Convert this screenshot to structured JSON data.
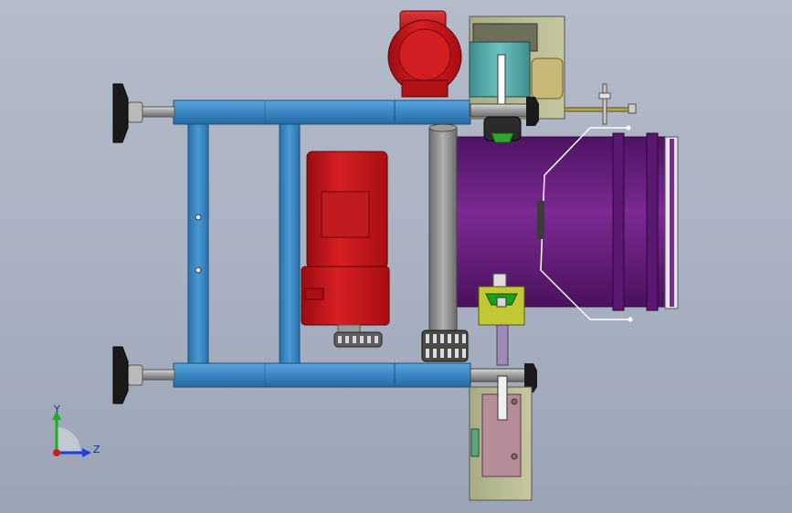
{
  "viewport": {
    "background_top": "#b4bccb",
    "background_bottom": "#9ba4b6"
  },
  "model": {
    "frame_color": "#3b87c4",
    "motor_color": "#c4161c",
    "drum_color": "#6a1d80",
    "gearbox_color": "#54a8a6",
    "bracket_color": "#b4b88e",
    "roller_color": "#8c8c8c"
  },
  "triad": {
    "y_label": "Y",
    "z_label": "Z",
    "y_color": "#16b316",
    "z_color": "#1f3fd6",
    "x_color": "#d11b1b"
  }
}
